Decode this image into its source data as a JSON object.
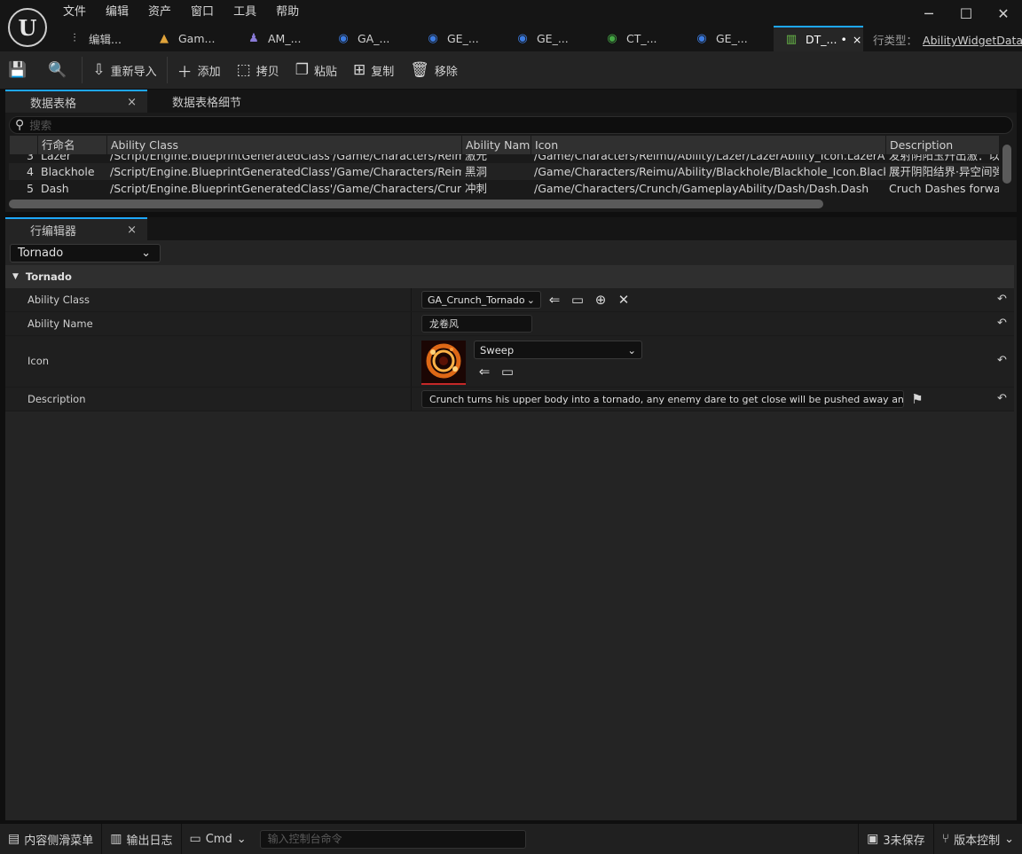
{
  "menu": [
    "文件",
    "编辑",
    "资产",
    "窗口",
    "工具",
    "帮助"
  ],
  "window_controls": {
    "minimize": "─",
    "maximize": "☐",
    "close": "✕"
  },
  "tabs": [
    {
      "label": "编辑...",
      "icon": "sliders-icon",
      "glyph": "⫶"
    },
    {
      "label": "Gam...",
      "icon": "gamemode-icon",
      "glyph": "▲"
    },
    {
      "label": "AM_...",
      "icon": "anim-montage-icon",
      "glyph": "♟"
    },
    {
      "label": "GA_...",
      "icon": "blueprint-icon",
      "glyph": "◉"
    },
    {
      "label": "GE_...",
      "icon": "blueprint-icon",
      "glyph": "◉"
    },
    {
      "label": "GE_...",
      "icon": "blueprint-icon",
      "glyph": "◉"
    },
    {
      "label": "CT_...",
      "icon": "curve-table-icon",
      "glyph": "◉"
    },
    {
      "label": "GE_...",
      "icon": "blueprint-icon",
      "glyph": "◉"
    },
    {
      "label": "DT_...",
      "icon": "data-table-icon",
      "glyph": "▥",
      "modified": "•",
      "close": "×"
    }
  ],
  "row_type": {
    "label": "行类型：",
    "value": "AbilityWidgetData"
  },
  "toolbar": {
    "save": "💾",
    "browse": "🔍",
    "reimport": "重新导入",
    "add": "添加",
    "copy": "拷贝",
    "paste": "粘贴",
    "duplicate": "复制",
    "remove": "移除"
  },
  "data_panel": {
    "tabs": [
      "数据表格",
      "数据表格细节"
    ],
    "search_placeholder": "搜索",
    "columns": [
      "",
      "行命名",
      "Ability Class",
      "Ability Name",
      "Icon",
      "Description"
    ],
    "rows": [
      [
        "3",
        "Lazer",
        "/Script/Engine.BlueprintGeneratedClass'/Game/Characters/Reimu/Ability",
        "激光",
        "/Game/Characters/Reimu/Ability/Lazer/LazerAbility_Icon.LazerAbility_Ic",
        "发射阴阳玉幵出激：以"
      ],
      [
        "4",
        "Blackhole",
        "/Script/Engine.BlueprintGeneratedClass'/Game/Characters/Reimu/Ability",
        "黑洞",
        "/Game/Characters/Reimu/Ability/Blackhole/Blackhole_Icon.Blackhole_Ic",
        "展开阴阳结界·异空间弹"
      ],
      [
        "5",
        "Dash",
        "/Script/Engine.BlueprintGeneratedClass'/Game/Characters/Crunch/Gam",
        "冲刺",
        "/Game/Characters/Crunch/GameplayAbility/Dash/Dash.Dash",
        "Cruch Dashes forward"
      ]
    ]
  },
  "row_editor": {
    "tab": "行编辑器",
    "selected_row": "Tornado",
    "category": "Tornado",
    "props": {
      "ability_class_label": "Ability Class",
      "ability_class_value": "GA_Crunch_Tornado",
      "ability_name_label": "Ability Name",
      "ability_name_value": "龙卷风",
      "icon_label": "Icon",
      "icon_value": "Sweep",
      "description_label": "Description",
      "description_value": "Crunch turns his upper body into a tornado, any enemy dare to get close will be pushed away and stuned"
    }
  },
  "statusbar": {
    "content_drawer": "内容侧滑菜单",
    "output_log": "输出日志",
    "cmd": "Cmd",
    "cmd_placeholder": "输入控制台命令",
    "unsaved": "3未保存",
    "source_control": "版本控制"
  },
  "colors": {
    "accent": "#1ea7fd",
    "panel": "#242424",
    "background": "#0f0f0f"
  }
}
